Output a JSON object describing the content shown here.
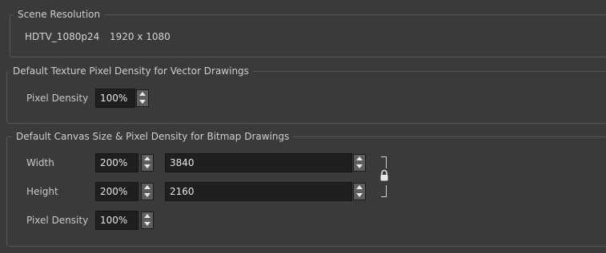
{
  "scene_resolution": {
    "title": "Scene Resolution",
    "preset": "HDTV_1080p24",
    "dimensions": "1920 x 1080"
  },
  "vector_density": {
    "title": "Default Texture Pixel Density for Vector Drawings",
    "pixel_density_label": "Pixel Density",
    "pixel_density_value": "100%"
  },
  "bitmap_canvas": {
    "title": "Default Canvas Size & Pixel Density for Bitmap Drawings",
    "width_label": "Width",
    "width_percent": "200%",
    "width_value": "3840",
    "height_label": "Height",
    "height_percent": "200%",
    "height_value": "2160",
    "pixel_density_label": "Pixel Density",
    "pixel_density_value": "100%",
    "lock_icon": "padlock-icon"
  },
  "colors": {
    "background": "#3a3a3a",
    "field_background": "#1f1f1f",
    "text": "#cfcfcf"
  }
}
